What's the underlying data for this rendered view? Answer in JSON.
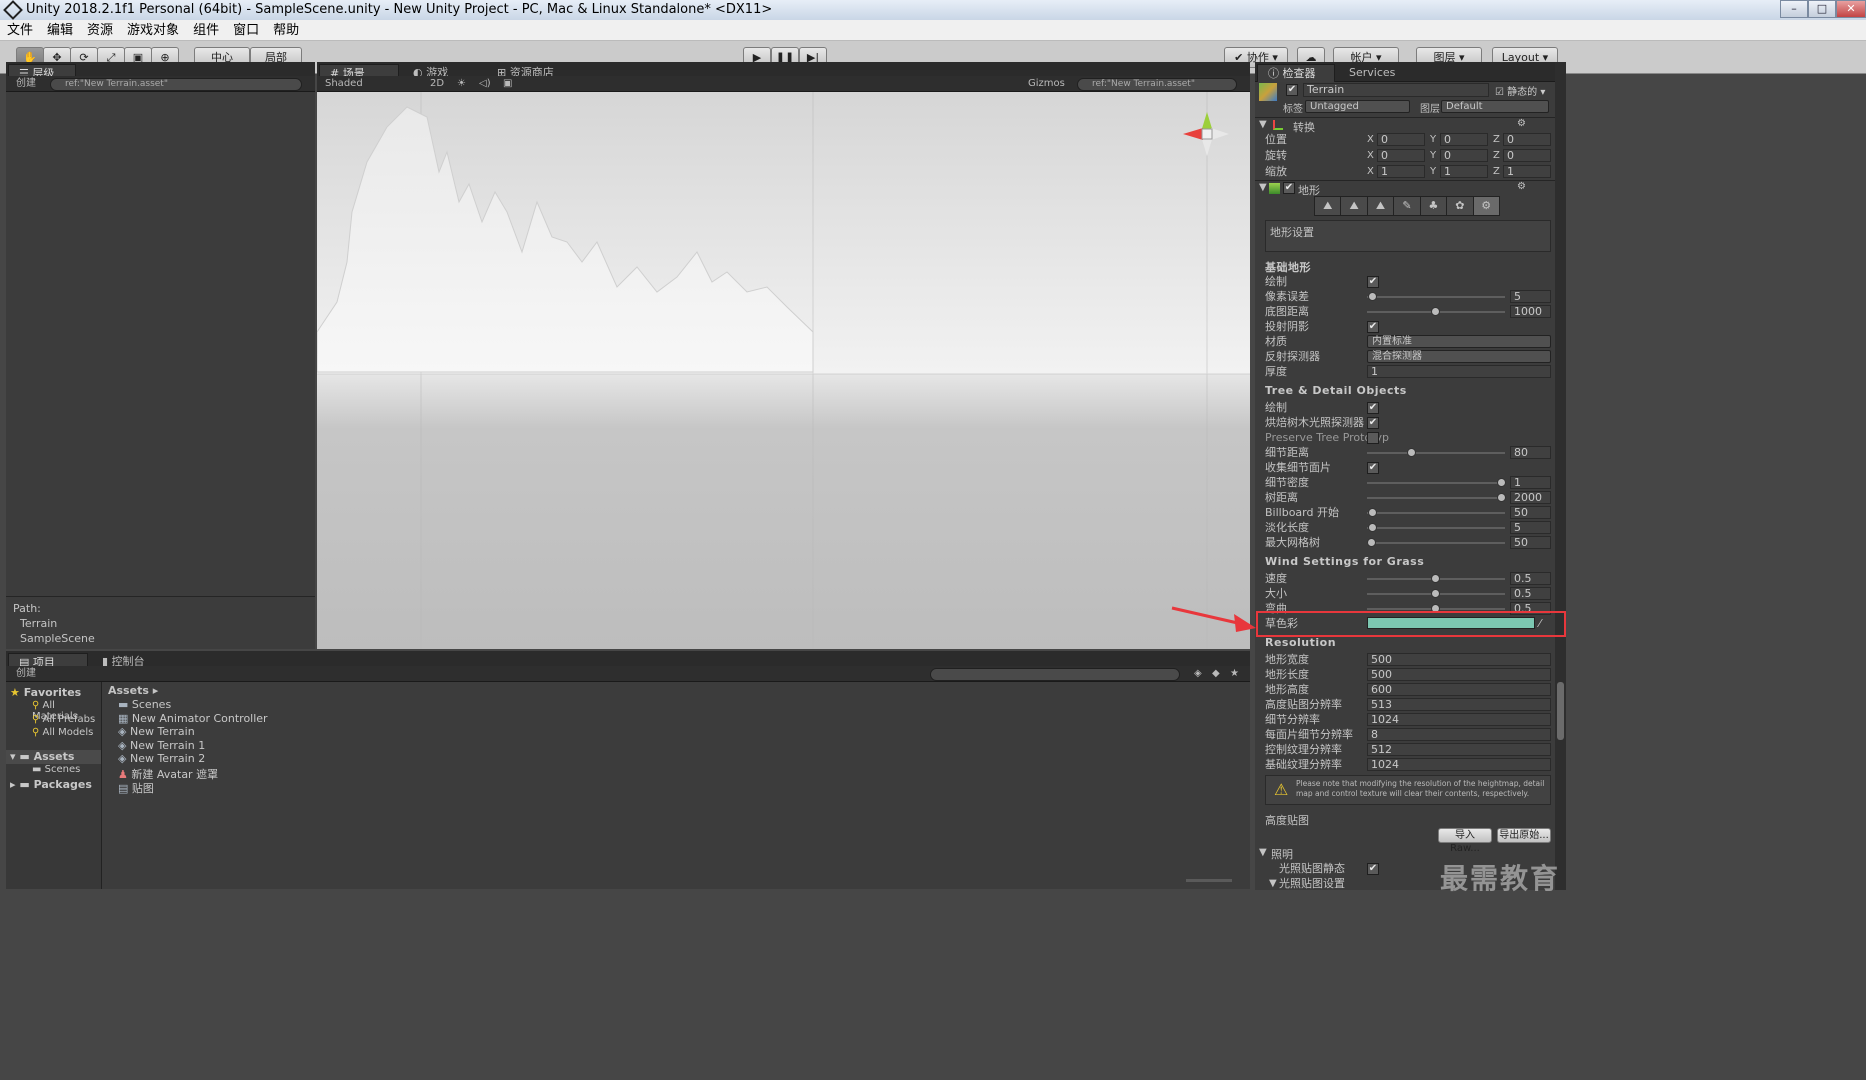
{
  "window": {
    "title": "Unity 2018.2.1f1 Personal (64bit) - SampleScene.unity - New Unity Project - PC, Mac & Linux Standalone* <DX11>"
  },
  "menu": [
    "文件",
    "编辑",
    "资源",
    "游戏对象",
    "组件",
    "窗口",
    "帮助"
  ],
  "toolbar": {
    "pivot": "中心",
    "space": "局部",
    "collab": "协作",
    "account": "帐户",
    "layers": "图层",
    "layout": "Layout"
  },
  "hierarchy": {
    "tab": "层级",
    "create": "创建",
    "search": "ref:\"New Terrain.asset\"",
    "path_label": "Path:",
    "path": [
      "Terrain",
      "SampleScene"
    ]
  },
  "scene_tabs": {
    "scene": "场景",
    "game": "游戏",
    "asset_store": "资源商店"
  },
  "scene_bar": {
    "shading": "Shaded",
    "mode2d": "2D",
    "gizmos": "Gizmos",
    "search": "ref:\"New Terrain.asset\""
  },
  "inspector": {
    "tab": "检查器",
    "services": "Services",
    "object_name": "Terrain",
    "static": "静态的",
    "tag_label": "标签",
    "tag": "Untagged",
    "layer_label": "图层",
    "layer": "Default",
    "transform": {
      "title": "转换",
      "rows": [
        {
          "label": "位置",
          "x": "0",
          "y": "0",
          "z": "0"
        },
        {
          "label": "旋转",
          "x": "0",
          "y": "0",
          "z": "0"
        },
        {
          "label": "缩放",
          "x": "1",
          "y": "1",
          "z": "1"
        }
      ]
    },
    "terrain_title": "地形",
    "settings_box": "地形设置",
    "basic": {
      "title": "基础地形",
      "draw": "绘制",
      "pixel_error_label": "像素误差",
      "pixel_error": "5",
      "basemap_dist_label": "底图距离",
      "basemap_dist": "1000",
      "cast_shadows": "投射阴影",
      "material_label": "材质",
      "material": "内置标准",
      "reflection_label": "反射探测器",
      "reflection": "混合探测器",
      "thickness_label": "厚度",
      "thickness": "1"
    },
    "tree": {
      "title": "Tree & Detail Objects",
      "draw": "绘制",
      "bake_light": "烘焙树木光照探测器",
      "preserve": "Preserve Tree Prototyp",
      "detail_dist_label": "细节距离",
      "detail_dist": "80",
      "collect_patches": "收集细节面片",
      "detail_density_label": "细节密度",
      "detail_density": "1",
      "tree_dist_label": "树距离",
      "tree_dist": "2000",
      "billboard_label": "Billboard 开始",
      "billboard": "50",
      "fade_label": "淡化长度",
      "fade": "5",
      "max_mesh_label": "最大网格树",
      "max_mesh": "50"
    },
    "wind": {
      "title": "Wind Settings for Grass",
      "speed_label": "速度",
      "speed": "0.5",
      "size_label": "大小",
      "size": "0.5",
      "bending_label": "弯曲",
      "bending": "0.5",
      "tint_label": "草色彩",
      "tint": "#7cc7b1"
    },
    "resolution": {
      "title": "Resolution",
      "rows": [
        {
          "label": "地形宽度",
          "value": "500"
        },
        {
          "label": "地形长度",
          "value": "500"
        },
        {
          "label": "地形高度",
          "value": "600"
        },
        {
          "label": "高度贴图分辨率",
          "value": "513"
        },
        {
          "label": "细节分辨率",
          "value": "1024"
        },
        {
          "label": "每面片细节分辨率",
          "value": "8"
        },
        {
          "label": "控制纹理分辨率",
          "value": "512"
        },
        {
          "label": "基础纹理分辨率",
          "value": "1024"
        }
      ],
      "warning": "Please note that modifying the resolution of the heightmap, detail map and control texture will clear their contents, respectively."
    },
    "heightmap": {
      "title": "高度贴图",
      "import": "导入 Raw...",
      "export": "导出原始..."
    },
    "lighting": {
      "title": "照明",
      "lightmap_static": "光照贴图静态",
      "lightmap_settings": "光照贴图设置"
    }
  },
  "project": {
    "tab": "项目",
    "console": "控制台",
    "create": "创建",
    "favorites": {
      "title": "Favorites",
      "items": [
        "All Materials",
        "All Prefabs",
        "All Models"
      ]
    },
    "assets_tree": {
      "title": "Assets",
      "children": [
        "Scenes"
      ]
    },
    "packages": "Packages",
    "breadcrumb": "Assets",
    "files": [
      "Scenes",
      "New Animator Controller",
      "New Terrain",
      "New Terrain 1",
      "New Terrain 2",
      "新建 Avatar 遮罩",
      "贴图"
    ]
  },
  "watermark": "最需教育",
  "colors": {
    "highlight": "#e8373c",
    "grass_tint": "#7cc7b1",
    "panel": "#3c3c3c"
  }
}
